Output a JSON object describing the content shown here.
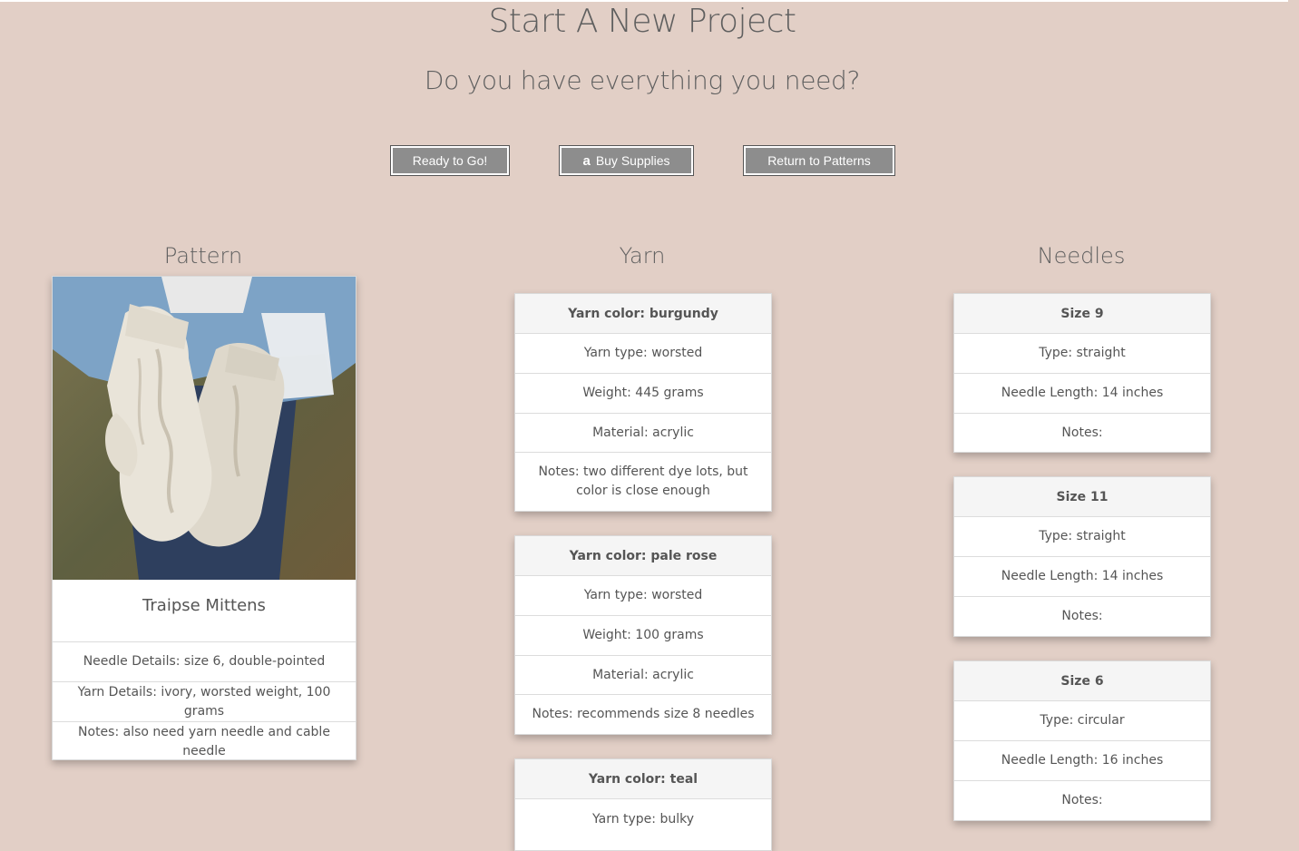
{
  "page": {
    "title": "Start A New Project",
    "subtitle": "Do you have everything you need?"
  },
  "buttons": {
    "ready": "Ready to Go!",
    "buy": "Buy Supplies",
    "buy_icon_glyph": "a",
    "return": "Return to Patterns"
  },
  "columns": {
    "pattern": "Pattern",
    "yarn": "Yarn",
    "needles": "Needles"
  },
  "pattern": {
    "image_icon": "mittens-photo",
    "name": "Traipse Mittens",
    "details": [
      "Needle Details: size 6, double-pointed",
      "Yarn Details: ivory, worsted weight, 100 grams",
      "Notes: also need yarn needle and cable needle"
    ]
  },
  "yarns": [
    {
      "color": "Yarn color: burgundy",
      "type": "Yarn type: worsted",
      "weight": "Weight: 445 grams",
      "material": "Material: acrylic",
      "notes": "Notes: two different dye lots, but color is close enough"
    },
    {
      "color": "Yarn color: pale rose",
      "type": "Yarn type: worsted",
      "weight": "Weight: 100 grams",
      "material": "Material: acrylic",
      "notes": "Notes: recommends size 8 needles"
    },
    {
      "color": "Yarn color: teal",
      "type": "Yarn type: bulky"
    }
  ],
  "needles": [
    {
      "size": "Size 9",
      "type": "Type: straight",
      "length": "Needle Length: 14 inches",
      "notes": "Notes:"
    },
    {
      "size": "Size 11",
      "type": "Type: straight",
      "length": "Needle Length: 14 inches",
      "notes": "Notes:"
    },
    {
      "size": "Size 6",
      "type": "Type: circular",
      "length": "Needle Length: 16 inches",
      "notes": "Notes:"
    }
  ],
  "colors": {
    "background": "#e2cfc6",
    "button_fill": "#8d8d8d",
    "card_header": "#f5f5f5"
  }
}
